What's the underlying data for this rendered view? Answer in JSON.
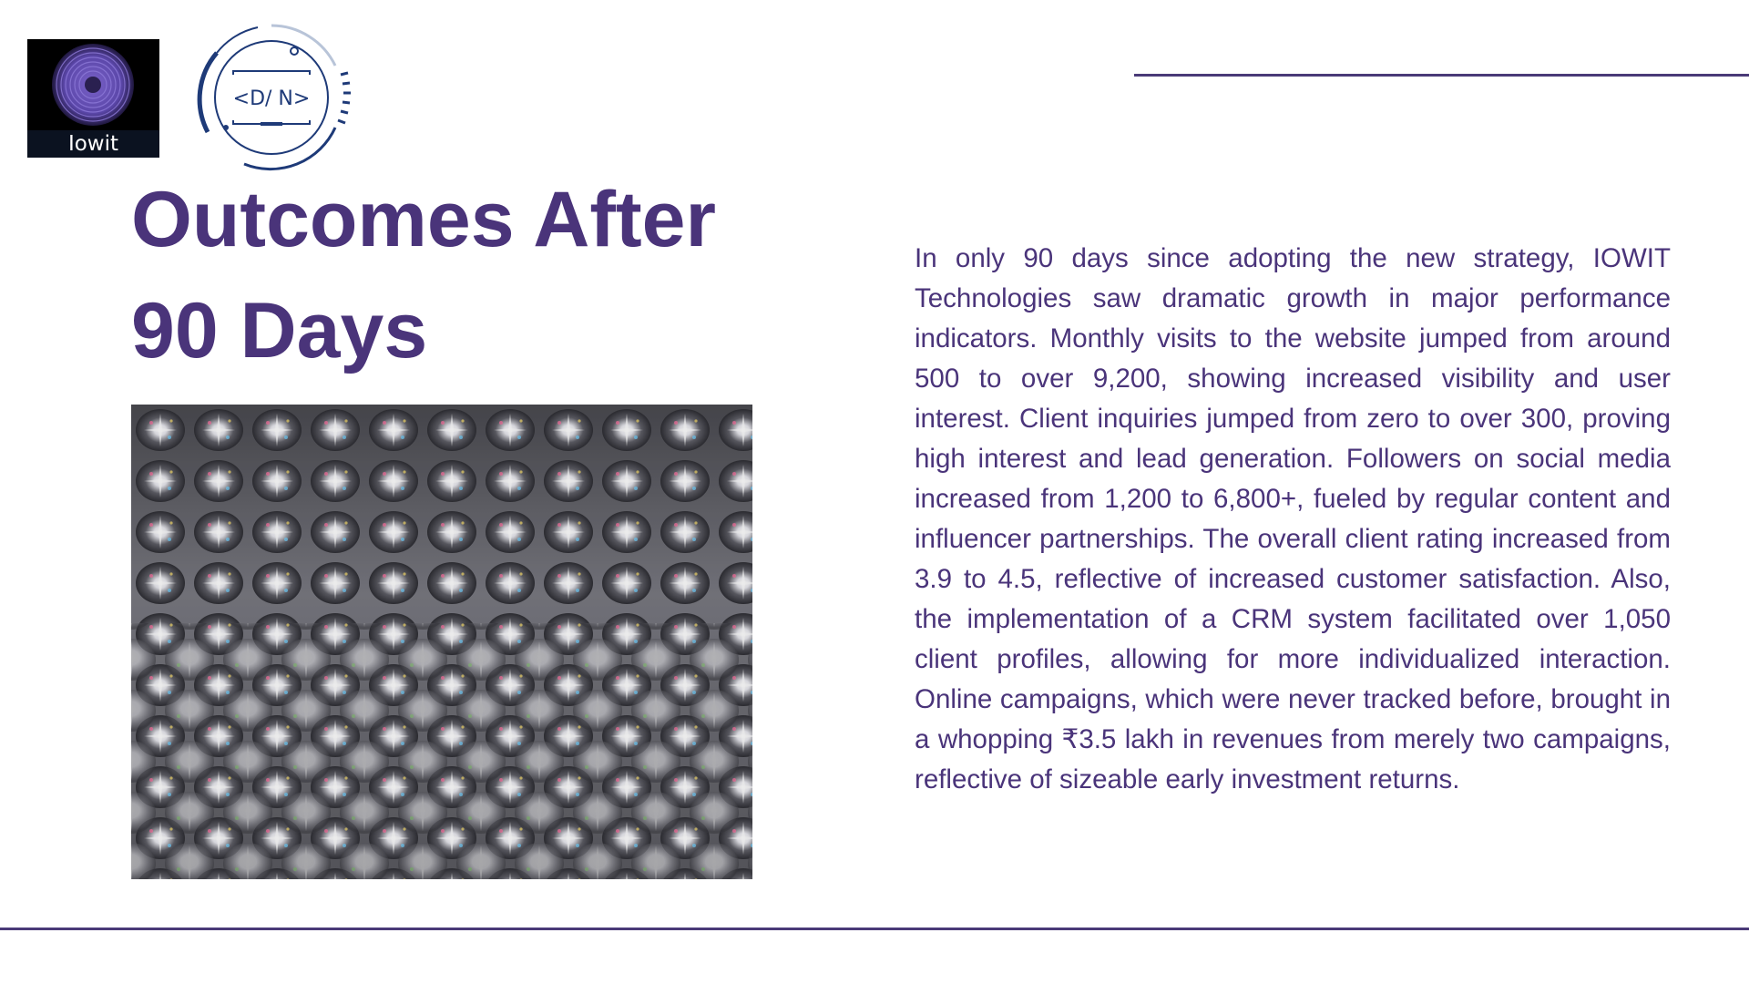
{
  "logos": {
    "left_logo_text": "Iowit",
    "left_logo_icon": "concentric-circles-logo",
    "right_logo_text": "<D/ N>",
    "right_logo_icon": "circular-tech-ring-logo"
  },
  "title": {
    "line1": "Outcomes After",
    "line2": "90 Days"
  },
  "image": {
    "description_icon": "crystal-lens-pattern-photo"
  },
  "body": {
    "paragraph": "In only 90 days since adopting the new strategy, IOWIT Technologies saw dramatic growth in major performance indicators. Monthly visits to the website jumped from around 500 to over 9,200, showing increased visibility and user interest. Client inquiries jumped from zero to over 300, proving high interest and lead generation. Followers on social media increased from 1,200 to 6,800+, fueled by regular content and influencer partnerships. The overall client rating increased from 3.9 to 4.5, reflective of increased customer satisfaction. Also, the implementation of a CRM system facilitated over 1,050 client profiles, allowing for more individualized interaction. Online campaigns, which were never tracked before, brought in a whopping ₹3.5 lakh in revenues from merely two campaigns, reflective of sizeable early investment returns."
  },
  "colors": {
    "accent": "#4a347a",
    "line": "#4a3a78",
    "background": "#ffffff"
  }
}
